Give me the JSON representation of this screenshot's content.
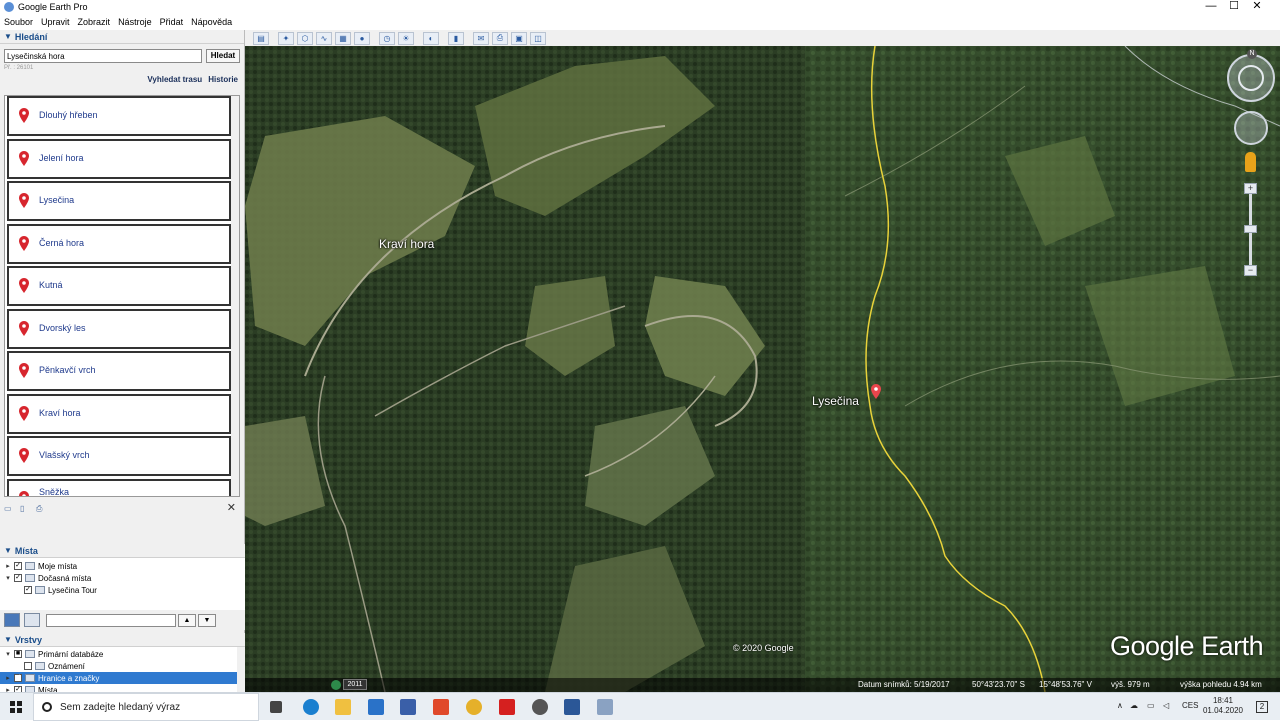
{
  "window": {
    "title": "Google Earth Pro",
    "controls": [
      "—",
      "☐",
      "✕"
    ]
  },
  "menu": [
    "Soubor",
    "Upravit",
    "Zobrazit",
    "Nástroje",
    "Přidat",
    "Nápověda"
  ],
  "search": {
    "header": "Hledání",
    "input_value": "Lysečinská hora",
    "button": "Hledat",
    "pf": "Př. : 26101",
    "route_link": "Vyhledat trasu",
    "history_link": "Historie",
    "results": [
      "Dlouhý hřeben",
      "Jelení hora",
      "Lysečina",
      "Černá hora",
      "Kutná",
      "Dvorský les",
      "Pěnkavčí vrch",
      "Kraví hora",
      "Vlašský vrch",
      "Sněžka"
    ]
  },
  "places": {
    "header": "Místa",
    "items": [
      "Moje místa",
      "Dočasná místa",
      "Lysečina Tour"
    ]
  },
  "layers": {
    "header": "Vrstvy",
    "items": [
      "Primární databáze",
      "Oznámení",
      "Hranice a značky",
      "Místa"
    ]
  },
  "map": {
    "labels": {
      "kravi": "Kraví hora",
      "lysecina": "Lysečina"
    },
    "copyright": "© 2020 Google",
    "brand": "Google Earth"
  },
  "statusbar": {
    "year": "2011",
    "date": "Datum snímků: 5/19/2017",
    "lat": "50°43'23.70\" S",
    "lon": "15°48'53.76\" V",
    "elev": "výš. 979 m",
    "eye": "výška pohledu 4.94 km"
  },
  "taskbar": {
    "search_placeholder": "Sem zadejte hledaný výraz",
    "lang": "CES",
    "time": "18:41",
    "date": "01.04.2020",
    "notif": "2"
  },
  "colors": {
    "pin": "#d7262e",
    "link": "#1f3a8c",
    "selection": "#2f7ad0",
    "trail": "#e8d23a"
  }
}
